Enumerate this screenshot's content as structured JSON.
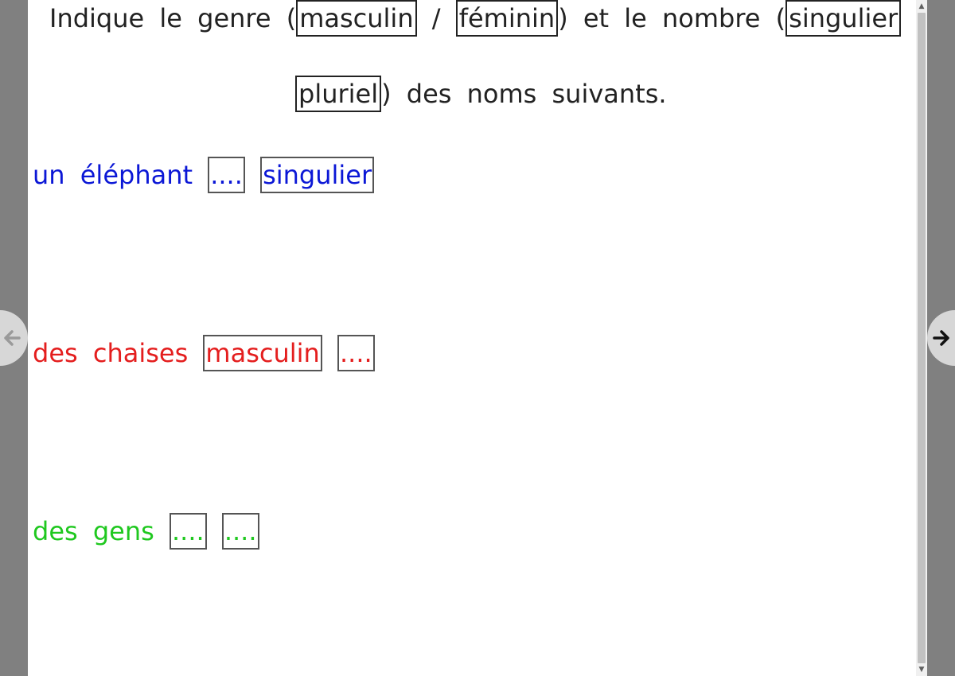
{
  "instruction": {
    "part1": "Indique le genre (",
    "box_masculin": "masculin",
    "sep1": " / ",
    "box_feminin": "féminin",
    "part2": ") et le nombre (",
    "box_singulier": "singulier",
    "sep2": " /",
    "box_pluriel": "pluriel",
    "part3": ") des noms suivants."
  },
  "exercises": [
    {
      "noun": "un éléphant",
      "genre": "....",
      "nombre": "singulier",
      "color": "#0b17d6"
    },
    {
      "noun": "des chaises",
      "genre": "masculin",
      "nombre": "....",
      "color": "#e41e1e"
    },
    {
      "noun": "des gens",
      "genre": "....",
      "nombre": "....",
      "color": "#1fc81f"
    }
  ],
  "navigation": {
    "prev_icon": "arrow-left-icon",
    "next_icon": "arrow-right-icon"
  },
  "scrollbar": {
    "up_arrow": "▲",
    "down_arrow": "▼"
  }
}
